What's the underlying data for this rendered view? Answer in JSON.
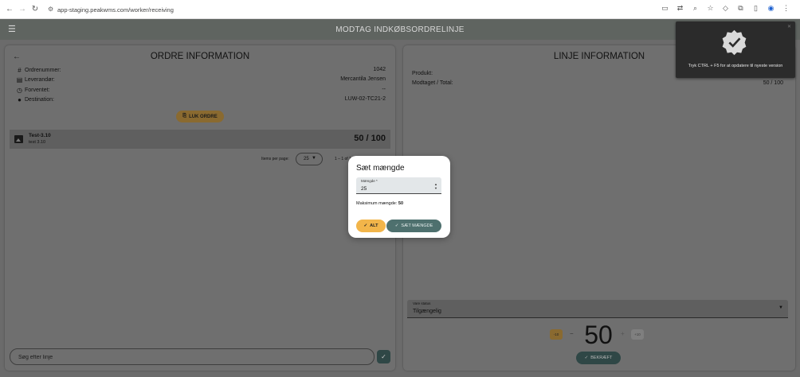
{
  "browser": {
    "url": "app-staging.peakwms.com/worker/receiving"
  },
  "appbar": {
    "title": "MODTAG INDKØBSORDRELINJE"
  },
  "order_panel": {
    "title": "ORDRE INFORMATION",
    "rows": [
      {
        "label": "Ordrenummer:",
        "value": "1042",
        "icon": "hash-icon"
      },
      {
        "label": "Leverandør:",
        "value": "Mercantila Jensen",
        "icon": "store-icon"
      },
      {
        "label": "Forventet:",
        "value": "--",
        "icon": "clock-icon"
      },
      {
        "label": "Destination:",
        "value": "LUW-02-TC21-2",
        "icon": "location-pin-icon"
      }
    ],
    "close_button": "LUK ORDRE",
    "line": {
      "name": "Test-3.10",
      "sub": "test 3.10",
      "qty": "50 / 100"
    },
    "pager": {
      "label": "Items per page:",
      "per_page": "25",
      "range": "1 – 1 of 1"
    },
    "search_placeholder": "Søg efter linje"
  },
  "line_panel": {
    "title": "LINJE INFORMATION",
    "product_label": "Produkt:",
    "received_label": "Modtaget / Total:",
    "received_value": "50 / 100",
    "status": {
      "label": "Vare status",
      "value": "Tilgængelig"
    },
    "qty": {
      "dec_label": "-10",
      "minus": "−",
      "value": "50",
      "plus": "+",
      "inc_label": "+10"
    },
    "confirm_button": "BEKRÆFT"
  },
  "toast": {
    "text": "Tryk CTRL + F5 for at opdatere til nyeste version"
  },
  "dialog": {
    "title": "Sæt mængde",
    "field_label": "Mængde *",
    "field_value": "25",
    "max_label": "Maksimum mængde:",
    "max_value": "50",
    "all_button": "ALT",
    "set_button": "SÆT MÆNGDE"
  }
}
